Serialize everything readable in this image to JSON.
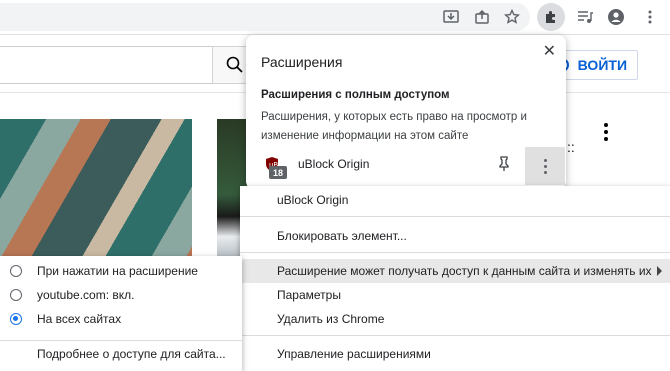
{
  "toolbar": {
    "icons": [
      "install-app-icon",
      "share-icon",
      "bookmark-star-icon",
      "extensions-puzzle-icon",
      "media-control-icon",
      "profile-avatar-icon"
    ]
  },
  "page": {
    "login_label": "ВОЙТИ",
    "side_text": "::"
  },
  "popup": {
    "title": "Расширения",
    "close": "✕",
    "section_title": "Расширения с полным доступом",
    "section_desc": "Расширения, у которых есть право на просмотр и изменение информации на этом сайте",
    "extension": {
      "name": "uBlock Origin",
      "badge": "18"
    }
  },
  "menu": {
    "items": [
      "uBlock Origin",
      "Блокировать элемент...",
      "Расширение может получать доступ к данным сайта и изменять их",
      "Параметры",
      "Удалить из Chrome",
      "Управление расширениями"
    ]
  },
  "submenu": {
    "options": [
      {
        "label": "При нажатии на расширение",
        "selected": false
      },
      {
        "label": "youtube.com: вкл.",
        "selected": false
      },
      {
        "label": "На всех сайтах",
        "selected": true
      }
    ],
    "link": "Подробнее о доступе для сайта..."
  },
  "colors": {
    "accent": "#1a73e8",
    "youtube_blue": "#065fd4",
    "ublock_red": "#800000"
  }
}
